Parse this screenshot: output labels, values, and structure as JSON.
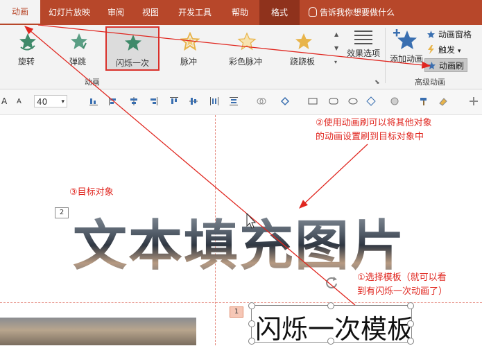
{
  "tabs": [
    {
      "label": "动画",
      "active": true
    },
    {
      "label": "幻灯片放映"
    },
    {
      "label": "审阅"
    },
    {
      "label": "视图"
    },
    {
      "label": "开发工具"
    },
    {
      "label": "帮助"
    },
    {
      "label": "格式"
    }
  ],
  "tell_me": "告诉我你想要做什么",
  "animations": [
    {
      "label": "旋转",
      "icon": "spin-star-icon",
      "color": "#3f8a6a"
    },
    {
      "label": "弹跳",
      "icon": "bounce-star-icon",
      "color": "#3f8a6a"
    },
    {
      "label": "闪烁一次",
      "icon": "flash-star-icon",
      "color": "#3f8a6a",
      "selected": true
    },
    {
      "label": "脉冲",
      "icon": "pulse-star-icon",
      "color": "#e8b44a"
    },
    {
      "label": "彩色脉冲",
      "icon": "color-pulse-star-icon",
      "color": "#e8b44a"
    },
    {
      "label": "跷跷板",
      "icon": "teeter-star-icon",
      "color": "#e8b44a"
    }
  ],
  "effect_options": "效果选项",
  "group_animation": "动画",
  "add_animation": "添加动画",
  "advanced": {
    "pane": "动画窗格",
    "trigger": "触发",
    "painter": "动画刷",
    "group_label": "高级动画"
  },
  "toolbar": {
    "font_size": "40"
  },
  "slide": {
    "main_text": "文本填充图片",
    "template_text": "闪烁一次模板",
    "num_main": "2",
    "num_template": "1"
  },
  "annotations": {
    "step2_line1": "②使用动画刷可以将其他对象",
    "step2_line2": "的动画设置刷到目标对象中",
    "step3": "③目标对象",
    "step1_line1": "①选择模板（就可以看",
    "step1_line2": "到有闪烁一次动画了）"
  },
  "colors": {
    "ribbon": "#b7472a",
    "annotation": "#e0261f"
  }
}
